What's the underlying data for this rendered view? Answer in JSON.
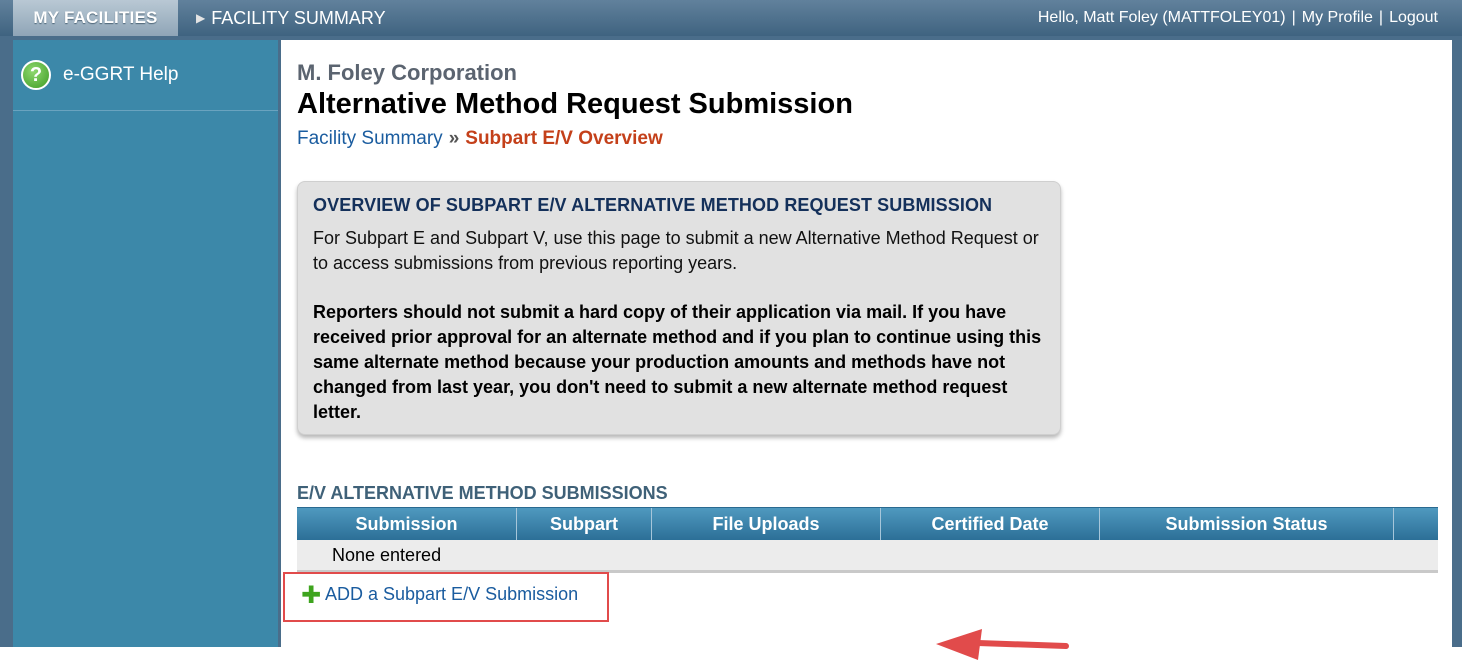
{
  "topbar": {
    "my_facilities": "MY FACILITIES",
    "facility_summary": "FACILITY SUMMARY",
    "greeting": "Hello, Matt Foley (MATTFOLEY01)",
    "separator": "|",
    "my_profile": "My Profile",
    "logout": "Logout"
  },
  "sidebar": {
    "items": [
      {
        "label": "e-GGRT Help",
        "icon": "help-question-icon"
      }
    ]
  },
  "header": {
    "company": "M. Foley Corporation",
    "title": "Alternative Method Request Submission"
  },
  "breadcrumb": {
    "link": "Facility Summary",
    "separator": "»",
    "current": "Subpart E/V Overview"
  },
  "overview": {
    "title": "OVERVIEW OF SUBPART E/V ALTERNATIVE METHOD REQUEST SUBMISSION",
    "text": "For Subpart E and Subpart V, use this page to submit a new Alternative Method Request or to access submissions from previous reporting years.",
    "bold_text": "Reporters should not submit a hard copy of their application via mail. If you have received prior approval for an alternate method and if you plan to continue using this same alternate method because your production amounts and methods have not changed from last year, you don't need to submit a new alternate method request letter."
  },
  "submissions": {
    "section_title": "E/V ALTERNATIVE METHOD SUBMISSIONS",
    "columns": [
      "Submission",
      "Subpart",
      "File Uploads",
      "Certified Date",
      "Submission Status"
    ],
    "empty_text": "None entered",
    "add_label": "ADD a Subpart E/V Submission",
    "add_icon": "plus-icon"
  },
  "colors": {
    "topbar": "#4f7391",
    "sidebar": "#3c88a9",
    "table_header": "#3a82ab",
    "breadcrumb_current": "#c4401a",
    "link": "#1a5c9f",
    "highlight": "#e14b4b"
  }
}
